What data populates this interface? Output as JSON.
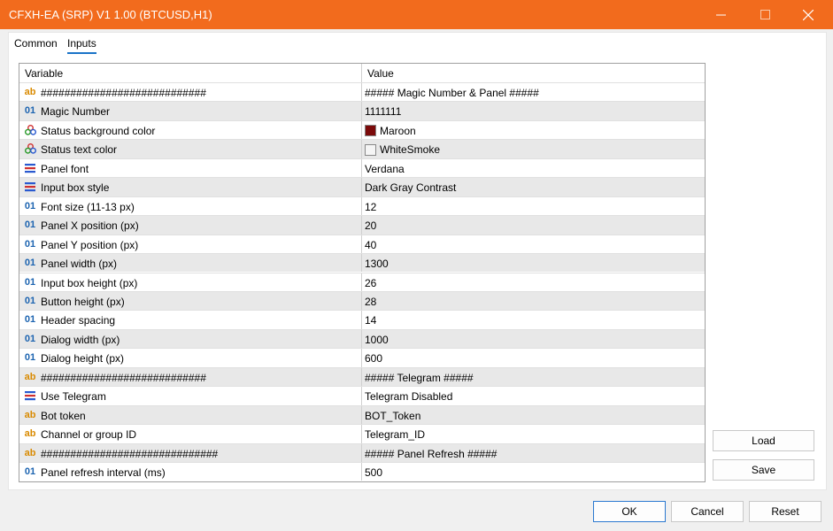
{
  "window": {
    "title": "CFXH-EA (SRP) V1 1.00 (BTCUSD,H1)"
  },
  "tabs": [
    {
      "label": "Common"
    },
    {
      "label": "Inputs",
      "active": true
    }
  ],
  "table": {
    "headers": {
      "variable": "Variable",
      "value": "Value"
    },
    "rows": [
      {
        "icon": "ab",
        "variable": "############################",
        "value": "##### Magic Number & Panel #####"
      },
      {
        "icon": "01",
        "variable": "Magic Number",
        "value": "1111111"
      },
      {
        "icon": "color",
        "variable": "Status background color",
        "value": "Maroon",
        "swatch": "#7b0a0a"
      },
      {
        "icon": "color",
        "variable": "Status text color",
        "value": "WhiteSmoke",
        "swatch": "#f5f5f5"
      },
      {
        "icon": "enum",
        "variable": "Panel font",
        "value": "Verdana"
      },
      {
        "icon": "enum",
        "variable": "Input box style",
        "value": "Dark Gray Contrast"
      },
      {
        "icon": "01",
        "variable": "Font size (11-13 px)",
        "value": "12"
      },
      {
        "icon": "01",
        "variable": "Panel X position (px)",
        "value": "20"
      },
      {
        "icon": "01",
        "variable": "Panel Y position (px)",
        "value": "40"
      },
      {
        "icon": "01",
        "variable": "Panel width (px)",
        "value": "1300"
      },
      {
        "icon": "01",
        "variable": "Input box height (px)",
        "value": "26"
      },
      {
        "icon": "01",
        "variable": "Button height (px)",
        "value": "28"
      },
      {
        "icon": "01",
        "variable": "Header spacing",
        "value": "14"
      },
      {
        "icon": "01",
        "variable": "Dialog width (px)",
        "value": "1000"
      },
      {
        "icon": "01",
        "variable": "Dialog height (px)",
        "value": "600"
      },
      {
        "icon": "ab",
        "variable": "############################",
        "value": "##### Telegram #####"
      },
      {
        "icon": "enum",
        "variable": "Use Telegram",
        "value": "Telegram Disabled"
      },
      {
        "icon": "ab",
        "variable": "Bot token",
        "value": "BOT_Token"
      },
      {
        "icon": "ab",
        "variable": "Channel or group ID",
        "value": "Telegram_ID"
      },
      {
        "icon": "ab",
        "variable": "##############################",
        "value": "##### Panel Refresh #####"
      },
      {
        "icon": "01",
        "variable": "Panel refresh interval (ms)",
        "value": "500"
      }
    ]
  },
  "side_buttons": {
    "load": "Load",
    "save": "Save"
  },
  "footer_buttons": {
    "ok": "OK",
    "cancel": "Cancel",
    "reset": "Reset"
  },
  "colors": {
    "titlebar": "#f26b1d",
    "accent": "#1a73c8"
  }
}
